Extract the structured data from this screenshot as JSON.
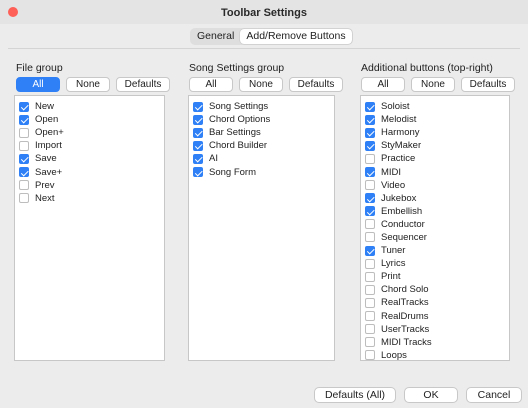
{
  "window": {
    "title": "Toolbar Settings"
  },
  "tabs": [
    "General",
    "Add/Remove Buttons"
  ],
  "groups": {
    "file": {
      "label": "File group",
      "buttons": {
        "all": "All",
        "none": "None",
        "defaults": "Defaults"
      },
      "items": [
        {
          "label": "New",
          "checked": true
        },
        {
          "label": "Open",
          "checked": true
        },
        {
          "label": "Open+",
          "checked": false
        },
        {
          "label": "Import",
          "checked": false
        },
        {
          "label": "Save",
          "checked": true
        },
        {
          "label": "Save+",
          "checked": true
        },
        {
          "label": "Prev",
          "checked": false
        },
        {
          "label": "Next",
          "checked": false
        }
      ]
    },
    "song": {
      "label": "Song Settings group",
      "buttons": {
        "all": "All",
        "none": "None",
        "defaults": "Defaults"
      },
      "items": [
        {
          "label": "Song Settings",
          "checked": true
        },
        {
          "label": "Chord Options",
          "checked": true
        },
        {
          "label": "Bar Settings",
          "checked": true
        },
        {
          "label": "Chord Builder",
          "checked": true
        },
        {
          "label": "AI",
          "checked": true
        },
        {
          "label": "Song Form",
          "checked": true
        }
      ]
    },
    "additional": {
      "label": "Additional buttons (top-right)",
      "buttons": {
        "all": "All",
        "none": "None",
        "defaults": "Defaults"
      },
      "items": [
        {
          "label": "Soloist",
          "checked": true
        },
        {
          "label": "Melodist",
          "checked": true
        },
        {
          "label": "Harmony",
          "checked": true
        },
        {
          "label": "StyMaker",
          "checked": true
        },
        {
          "label": "Practice",
          "checked": false
        },
        {
          "label": "MIDI",
          "checked": true
        },
        {
          "label": "Video",
          "checked": false
        },
        {
          "label": "Jukebox",
          "checked": true
        },
        {
          "label": "Embellish",
          "checked": true
        },
        {
          "label": "Conductor",
          "checked": false
        },
        {
          "label": "Sequencer",
          "checked": false
        },
        {
          "label": "Tuner",
          "checked": true
        },
        {
          "label": "Lyrics",
          "checked": false
        },
        {
          "label": "Print",
          "checked": false
        },
        {
          "label": "Chord Solo",
          "checked": false
        },
        {
          "label": "RealTracks",
          "checked": false
        },
        {
          "label": "RealDrums",
          "checked": false
        },
        {
          "label": "UserTracks",
          "checked": false
        },
        {
          "label": "MIDI Tracks",
          "checked": false
        },
        {
          "label": "Loops",
          "checked": false
        }
      ]
    }
  },
  "footer": {
    "defaults_all": "Defaults (All)",
    "ok": "OK",
    "cancel": "Cancel"
  },
  "colors": {
    "accent": "#2f80f6",
    "close": "#fe5f57"
  }
}
